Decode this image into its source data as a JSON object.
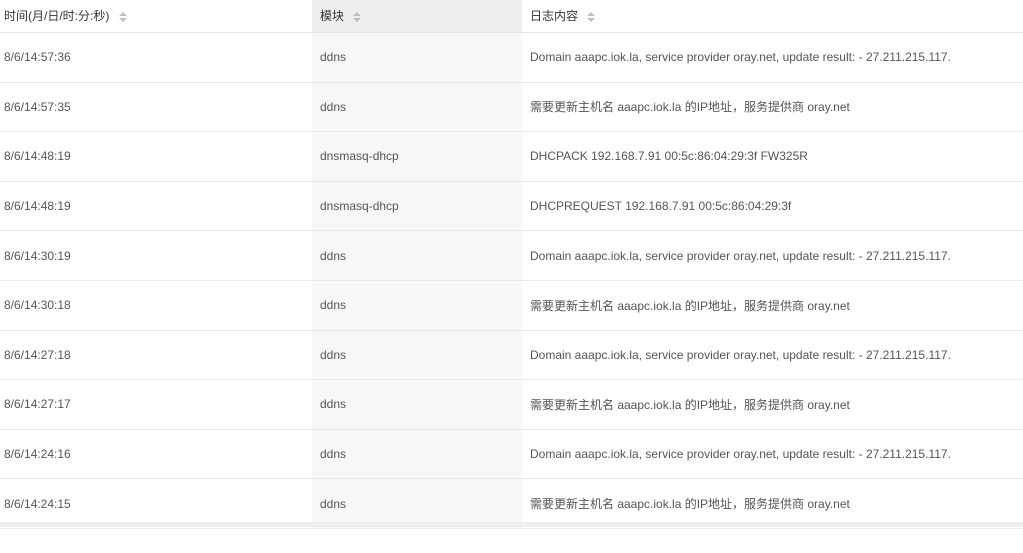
{
  "table": {
    "headers": {
      "time": "时间(月/日/时:分:秒)",
      "module": "模块",
      "message": "日志内容"
    },
    "rows": [
      {
        "time": "8/6/14:57:36",
        "module": "ddns",
        "message": "Domain aaapc.iok.la, service provider oray.net, update result: - 27.211.215.117."
      },
      {
        "time": "8/6/14:57:35",
        "module": "ddns",
        "message": "需要更新主机名 aaapc.iok.la 的IP地址，服务提供商 oray.net"
      },
      {
        "time": "8/6/14:48:19",
        "module": "dnsmasq-dhcp",
        "message": "DHCPACK 192.168.7.91 00:5c:86:04:29:3f FW325R"
      },
      {
        "time": "8/6/14:48:19",
        "module": "dnsmasq-dhcp",
        "message": "DHCPREQUEST 192.168.7.91 00:5c:86:04:29:3f"
      },
      {
        "time": "8/6/14:30:19",
        "module": "ddns",
        "message": "Domain aaapc.iok.la, service provider oray.net, update result: - 27.211.215.117."
      },
      {
        "time": "8/6/14:30:18",
        "module": "ddns",
        "message": "需要更新主机名 aaapc.iok.la 的IP地址，服务提供商 oray.net"
      },
      {
        "time": "8/6/14:27:18",
        "module": "ddns",
        "message": "Domain aaapc.iok.la, service provider oray.net, update result: - 27.211.215.117."
      },
      {
        "time": "8/6/14:27:17",
        "module": "ddns",
        "message": "需要更新主机名 aaapc.iok.la 的IP地址，服务提供商 oray.net"
      },
      {
        "time": "8/6/14:24:16",
        "module": "ddns",
        "message": "Domain aaapc.iok.la, service provider oray.net, update result: - 27.211.215.117."
      },
      {
        "time": "8/6/14:24:15",
        "module": "ddns",
        "message": "需要更新主机名 aaapc.iok.la 的IP地址，服务提供商 oray.net"
      }
    ]
  },
  "icons": {
    "sort": "sort-icon"
  },
  "colors": {
    "sorted_column_bg": "#eeeeee",
    "row_divider": "#e8e8e8",
    "text": "#555555"
  }
}
